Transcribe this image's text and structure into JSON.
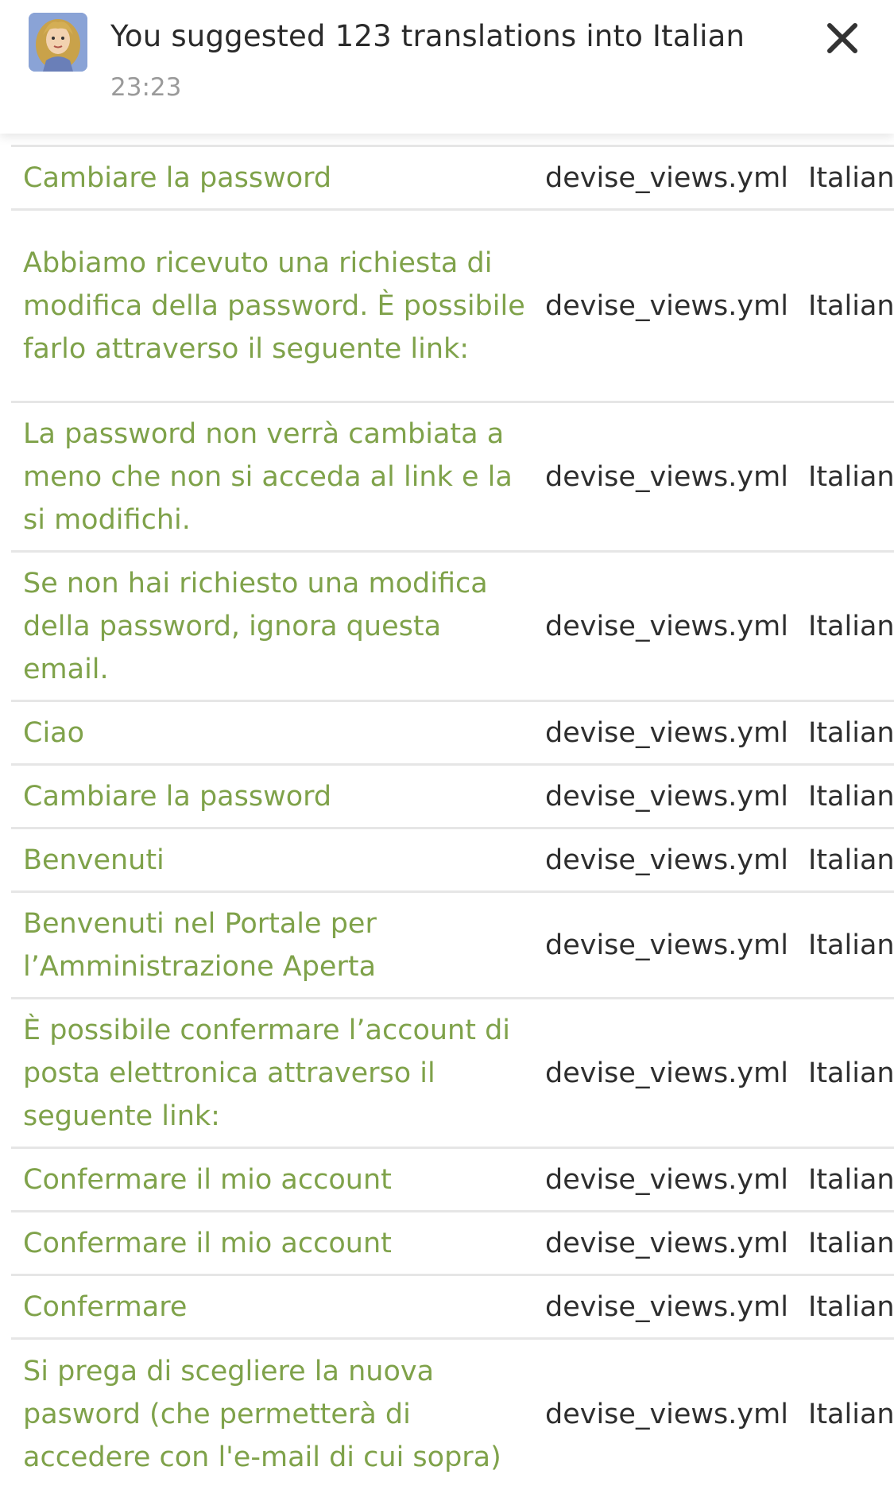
{
  "notification": {
    "title": "You suggested 123 translations into Italian",
    "time": "23:23",
    "avatar_icon": "user-avatar-icon",
    "close_icon": "close-icon"
  },
  "colors": {
    "translation_text": "#7fa24a",
    "file_text": "#2e2e2e",
    "divider": "#e6e6e6"
  },
  "rows": [
    {
      "text": "Cambiare la password",
      "file": "devise_views.yml",
      "lang": "Italian"
    },
    {
      "text": "Abbiamo ricevuto una richiesta di modifica della password. È possibile farlo attraverso il seguente link:",
      "file": "devise_views.yml",
      "lang": "Italian"
    },
    {
      "text": "La password non verrà cambiata a meno che non si acceda al link e la si modifichi.",
      "file": "devise_views.yml",
      "lang": "Italian"
    },
    {
      "text": "Se non hai richiesto una modifica della password, ignora questa email.",
      "file": "devise_views.yml",
      "lang": "Italian"
    },
    {
      "text": "Ciao",
      "file": "devise_views.yml",
      "lang": "Italian"
    },
    {
      "text": "Cambiare la password",
      "file": "devise_views.yml",
      "lang": "Italian"
    },
    {
      "text": "Benvenuti",
      "file": "devise_views.yml",
      "lang": "Italian"
    },
    {
      "text": "Benvenuti nel Portale per l’Amministrazione Aperta",
      "file": "devise_views.yml",
      "lang": "Italian"
    },
    {
      "text": "È possibile confermare l’account di posta elettronica attraverso il seguente link:",
      "file": "devise_views.yml",
      "lang": "Italian"
    },
    {
      "text": "Confermare il mio account",
      "file": "devise_views.yml",
      "lang": "Italian"
    },
    {
      "text": "Confermare il mio account",
      "file": "devise_views.yml",
      "lang": "Italian"
    },
    {
      "text": "Confermare",
      "file": "devise_views.yml",
      "lang": "Italian"
    },
    {
      "text": "Si prega di scegliere la nuova pasword (che permetterà di accedere con l'e-mail di cui sopra)",
      "file": "devise_views.yml",
      "lang": "Italian"
    }
  ]
}
